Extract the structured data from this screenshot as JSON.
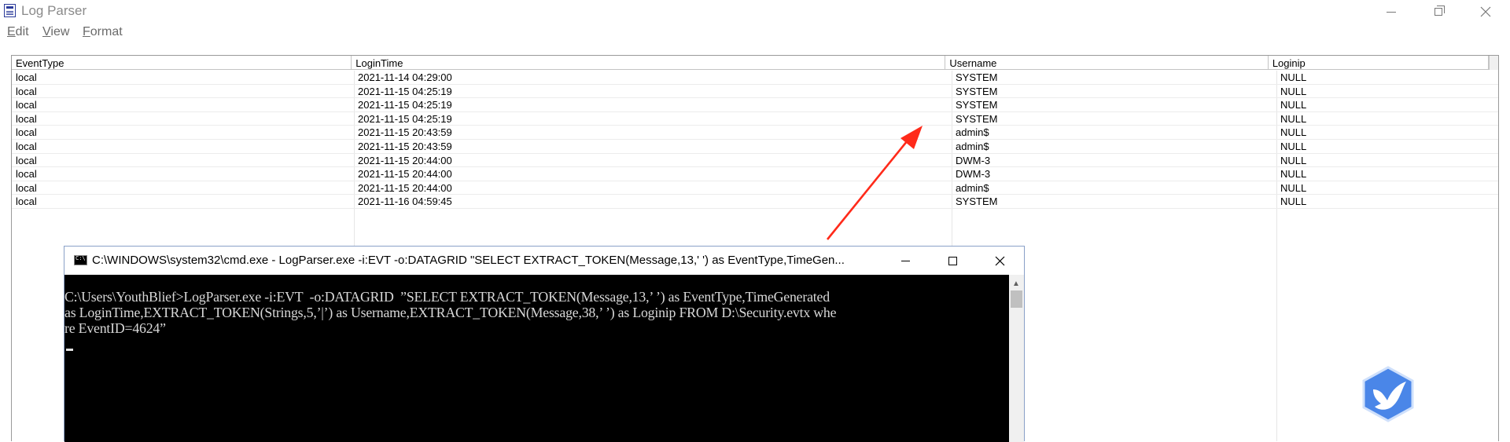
{
  "window": {
    "title": "Log Parser",
    "controls": {
      "minimize": "minimize-icon",
      "maximize": "restore-icon",
      "close": "close-icon"
    }
  },
  "menu": {
    "items": [
      {
        "label_acc": "E",
        "label_rest": "dit"
      },
      {
        "label_acc": "V",
        "label_rest": "iew"
      },
      {
        "label_acc": "F",
        "label_rest": "ormat"
      }
    ]
  },
  "grid": {
    "columns": [
      "EventType",
      "LoginTime",
      "Username",
      "Loginip"
    ],
    "rows": [
      [
        "local",
        "2021-11-14 04:29:00",
        "SYSTEM",
        "NULL"
      ],
      [
        "local",
        "2021-11-15 04:25:19",
        "SYSTEM",
        "NULL"
      ],
      [
        "local",
        "2021-11-15 04:25:19",
        "SYSTEM",
        "NULL"
      ],
      [
        "local",
        "2021-11-15 04:25:19",
        "SYSTEM",
        "NULL"
      ],
      [
        "local",
        "2021-11-15 20:43:59",
        "admin$",
        "NULL"
      ],
      [
        "local",
        "2021-11-15 20:43:59",
        "admin$",
        "NULL"
      ],
      [
        "local",
        "2021-11-15 20:44:00",
        "DWM-3",
        "NULL"
      ],
      [
        "local",
        "2021-11-15 20:44:00",
        "DWM-3",
        "NULL"
      ],
      [
        "local",
        "2021-11-15 20:44:00",
        "admin$",
        "NULL"
      ],
      [
        "local",
        "2021-11-16 04:59:45",
        "SYSTEM",
        "NULL"
      ]
    ]
  },
  "cmd": {
    "title": "C:\\WINDOWS\\system32\\cmd.exe - LogParser.exe  -i:EVT  -o:DATAGRID  \"SELECT EXTRACT_TOKEN(Message,13,' ') as EventType,TimeGen...",
    "lines": [
      "C:\\Users\\YouthBlief>LogParser.exe -i:EVT  -o:DATAGRID  ”SELECT EXTRACT_TOKEN(Message,13,’ ’) as EventType,TimeGenerated",
      "as LoginTime,EXTRACT_TOKEN(Strings,5,’|’) as Username,EXTRACT_TOKEN(Message,38,’ ’) as Loginip FROM D:\\Security.evtx whe",
      "re EventID=4624”"
    ]
  },
  "colors": {
    "annotation_arrow": "#ff2a1a",
    "console_bg": "#000000",
    "watermark": "#4a86e8"
  }
}
